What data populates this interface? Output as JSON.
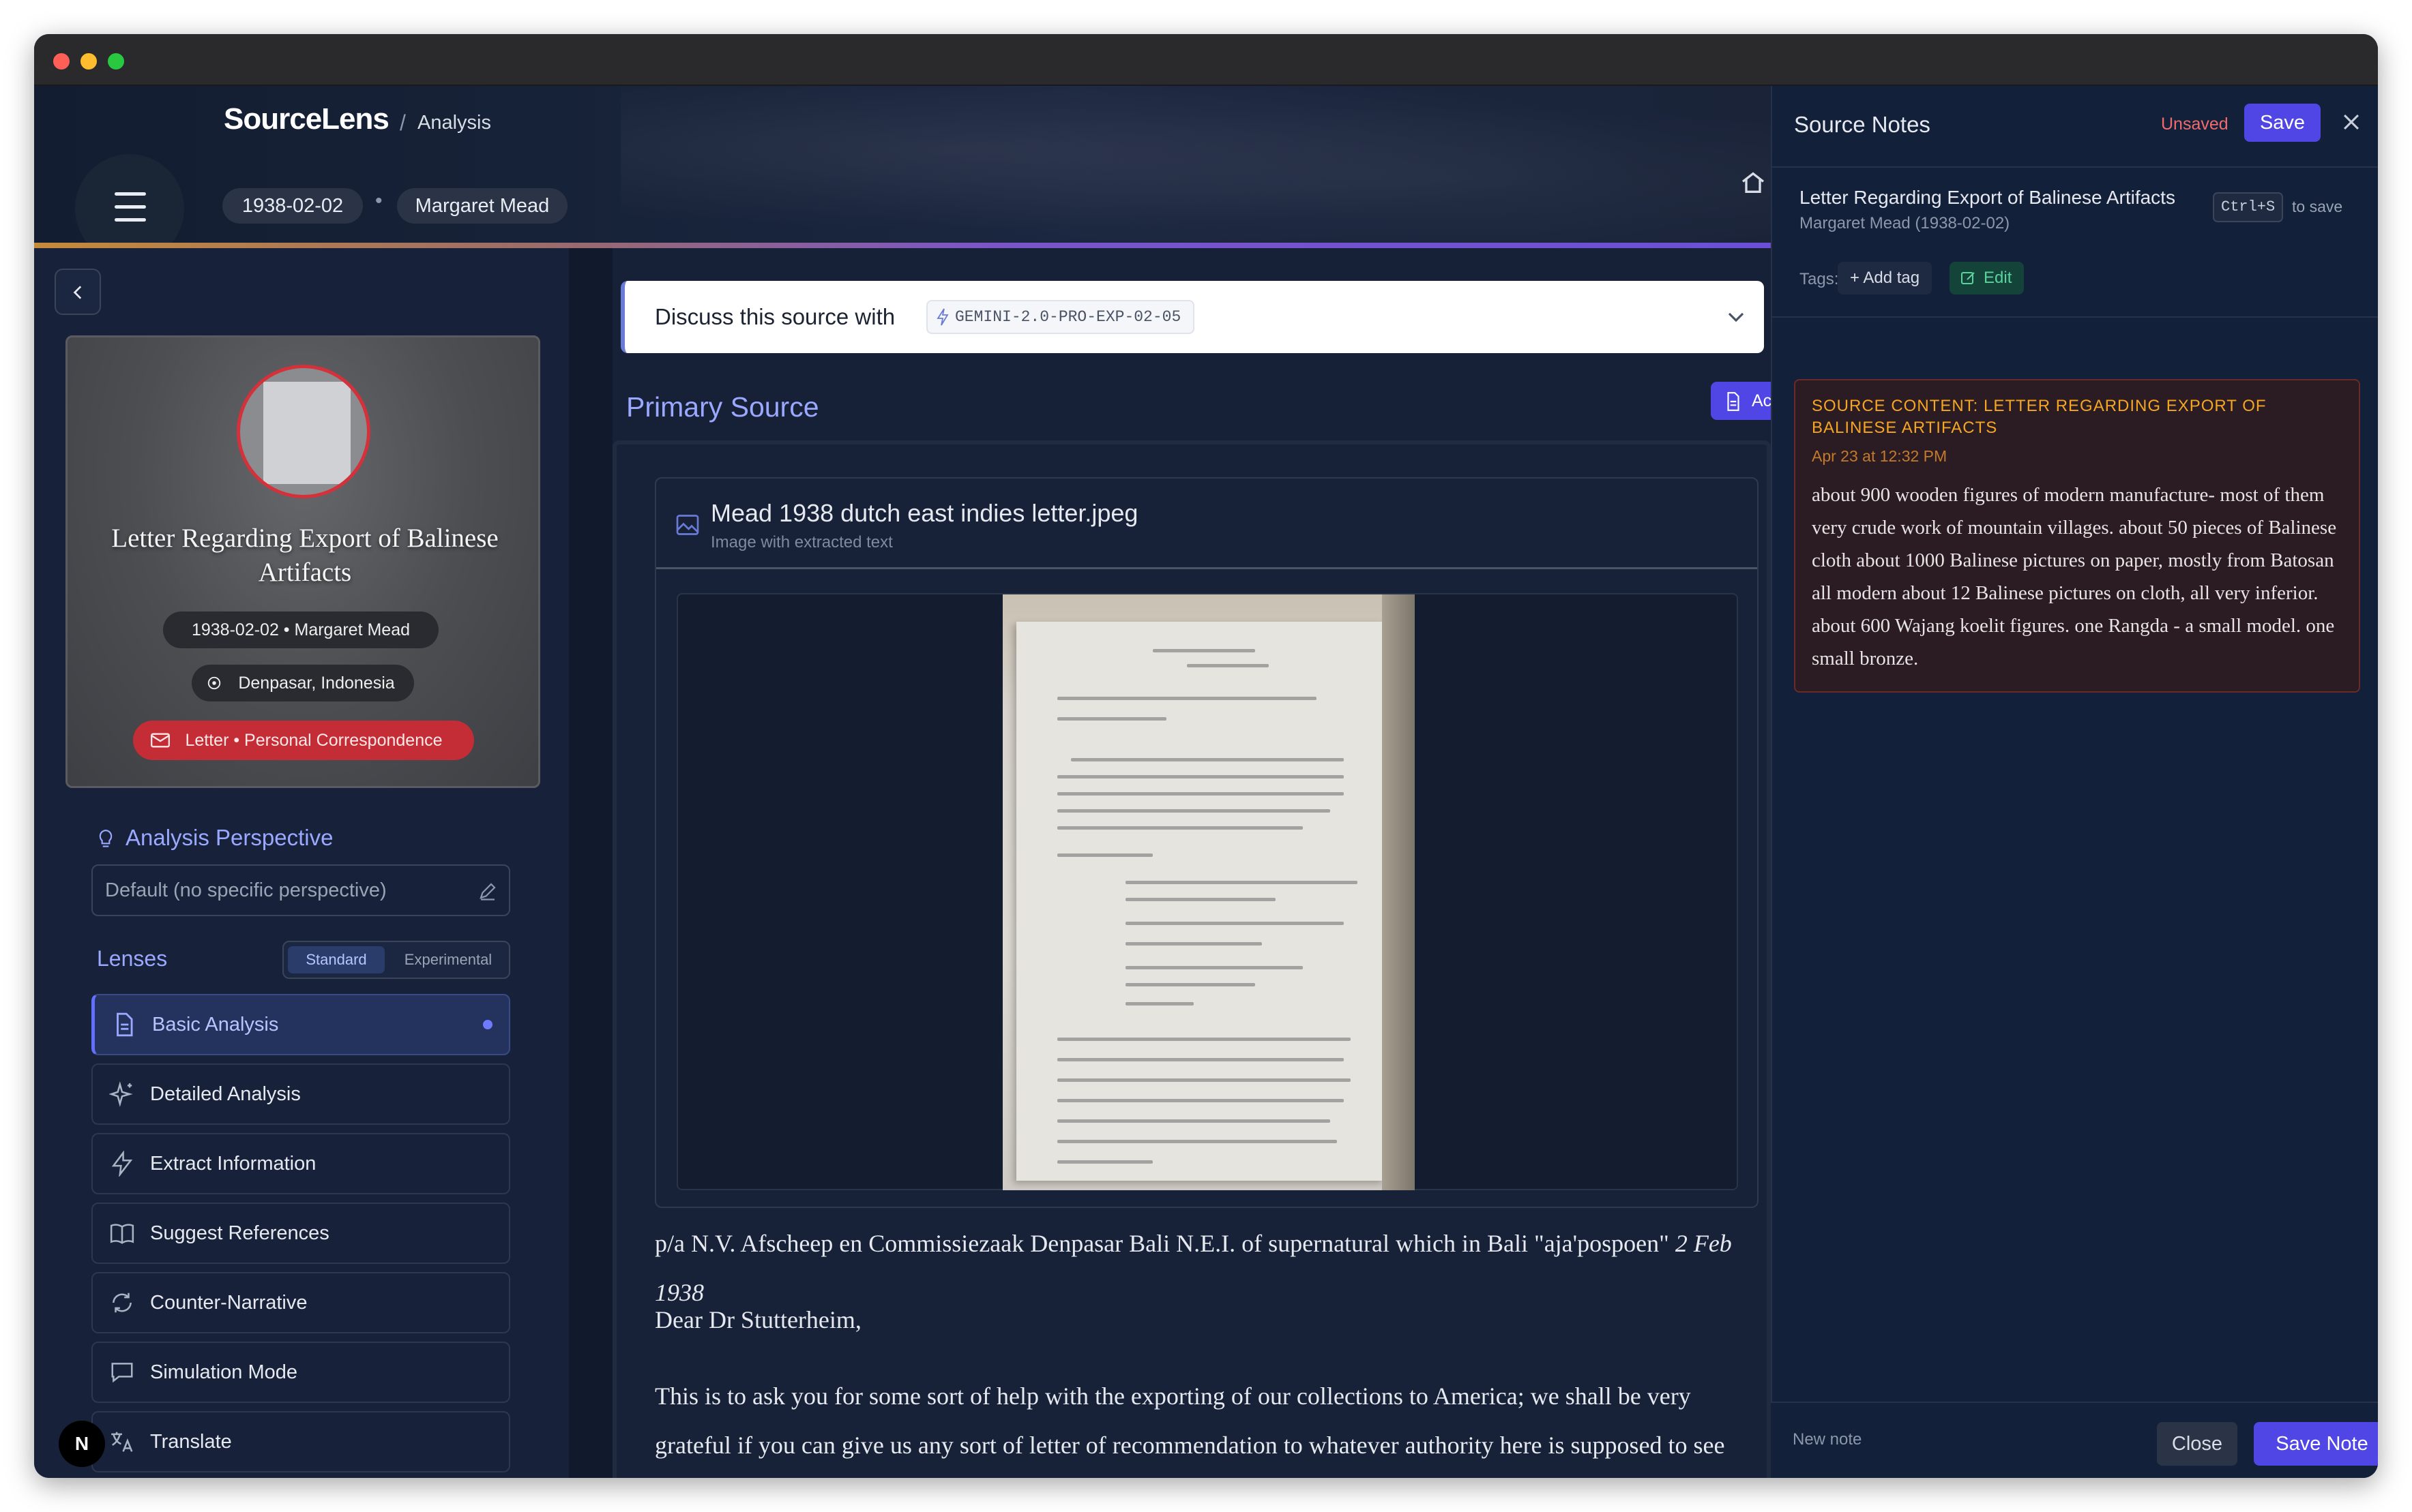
{
  "window": {
    "traffic_lights": [
      "#ff5f57",
      "#febc2e",
      "#28c840"
    ]
  },
  "header": {
    "app_name": "SourceLens",
    "breadcrumb_sep": "/",
    "breadcrumb": "Analysis",
    "date_chip": "1938-02-02",
    "author_chip": "Margaret Mead",
    "chip_sep": "•"
  },
  "sidebar": {
    "card": {
      "title": "Letter Regarding Export of Balinese Artifacts",
      "date_author": "1938-02-02 • Margaret Mead",
      "location": "Denpasar, Indonesia",
      "type": "Letter • Personal Correspondence"
    },
    "perspective": {
      "title": "Analysis Perspective",
      "value": "Default (no specific perspective)"
    },
    "lenses": {
      "label": "Lenses",
      "modes": [
        "Standard",
        "Experimental"
      ],
      "selected_mode": "Standard",
      "items": [
        {
          "label": "Basic Analysis",
          "icon": "document-icon",
          "active": true
        },
        {
          "label": "Detailed Analysis",
          "icon": "sparkle-icon",
          "active": false
        },
        {
          "label": "Extract Information",
          "icon": "bolt-icon",
          "active": false
        },
        {
          "label": "Suggest References",
          "icon": "book-icon",
          "active": false
        },
        {
          "label": "Counter-Narrative",
          "icon": "refresh-icon",
          "active": false
        },
        {
          "label": "Simulation Mode",
          "icon": "chat-icon",
          "active": false
        },
        {
          "label": "Translate",
          "icon": "translate-icon",
          "active": false
        }
      ]
    },
    "badge": "N"
  },
  "main": {
    "discuss_label": "Discuss this source with",
    "model": "GEMINI-2.0-PRO-EXP-02-05",
    "section_title": "Primary Source",
    "actions_label": "Actions",
    "file": {
      "name": "Mead 1938 dutch east indies letter.jpeg",
      "subtitle": "Image with extracted text"
    },
    "text": {
      "line1": "p/a N.V. Afscheep en Commissiezaak Denpasar Bali N.E.I. of supernatural which in Bali \"aja'pospoen\" ",
      "line1_date": "2 Feb 1938",
      "salutation": "Dear Dr Stutterheim,",
      "para": "This is to ask you for some sort of help with the exporting of our collections to America; we shall be very grateful if you can give us any sort of letter of recommendation to whatever authority here is supposed to see that we do not take"
    }
  },
  "notes": {
    "title": "Source Notes",
    "status": "Unsaved",
    "save_label": "Save",
    "source_title": "Letter Regarding Export of Balinese Artifacts",
    "shortcut": "Ctrl+S",
    "shortcut_hint": "to save",
    "author_date": "Margaret Mead  (1938-02-02)",
    "tags_label": "Tags:",
    "add_tag": "+ Add tag",
    "edit_label": "Edit",
    "note": {
      "heading": "SOURCE CONTENT: LETTER REGARDING EXPORT OF BALINESE ARTIFACTS",
      "time": "Apr 23 at 12:32 PM",
      "body": "about 900 wooden figures of modern manufacture- most of them very crude work of mountain villages. about 50 pieces of Balinese cloth about 1000 Balinese pictures on paper, mostly from Batosan all modern about 12 Balinese pictures on cloth, all very inferior. about 600 Wajang koelit figures. one Rangda - a small model. one small bronze."
    },
    "footer": {
      "new_note": "New note",
      "close": "Close",
      "save_note": "Save Note"
    }
  }
}
